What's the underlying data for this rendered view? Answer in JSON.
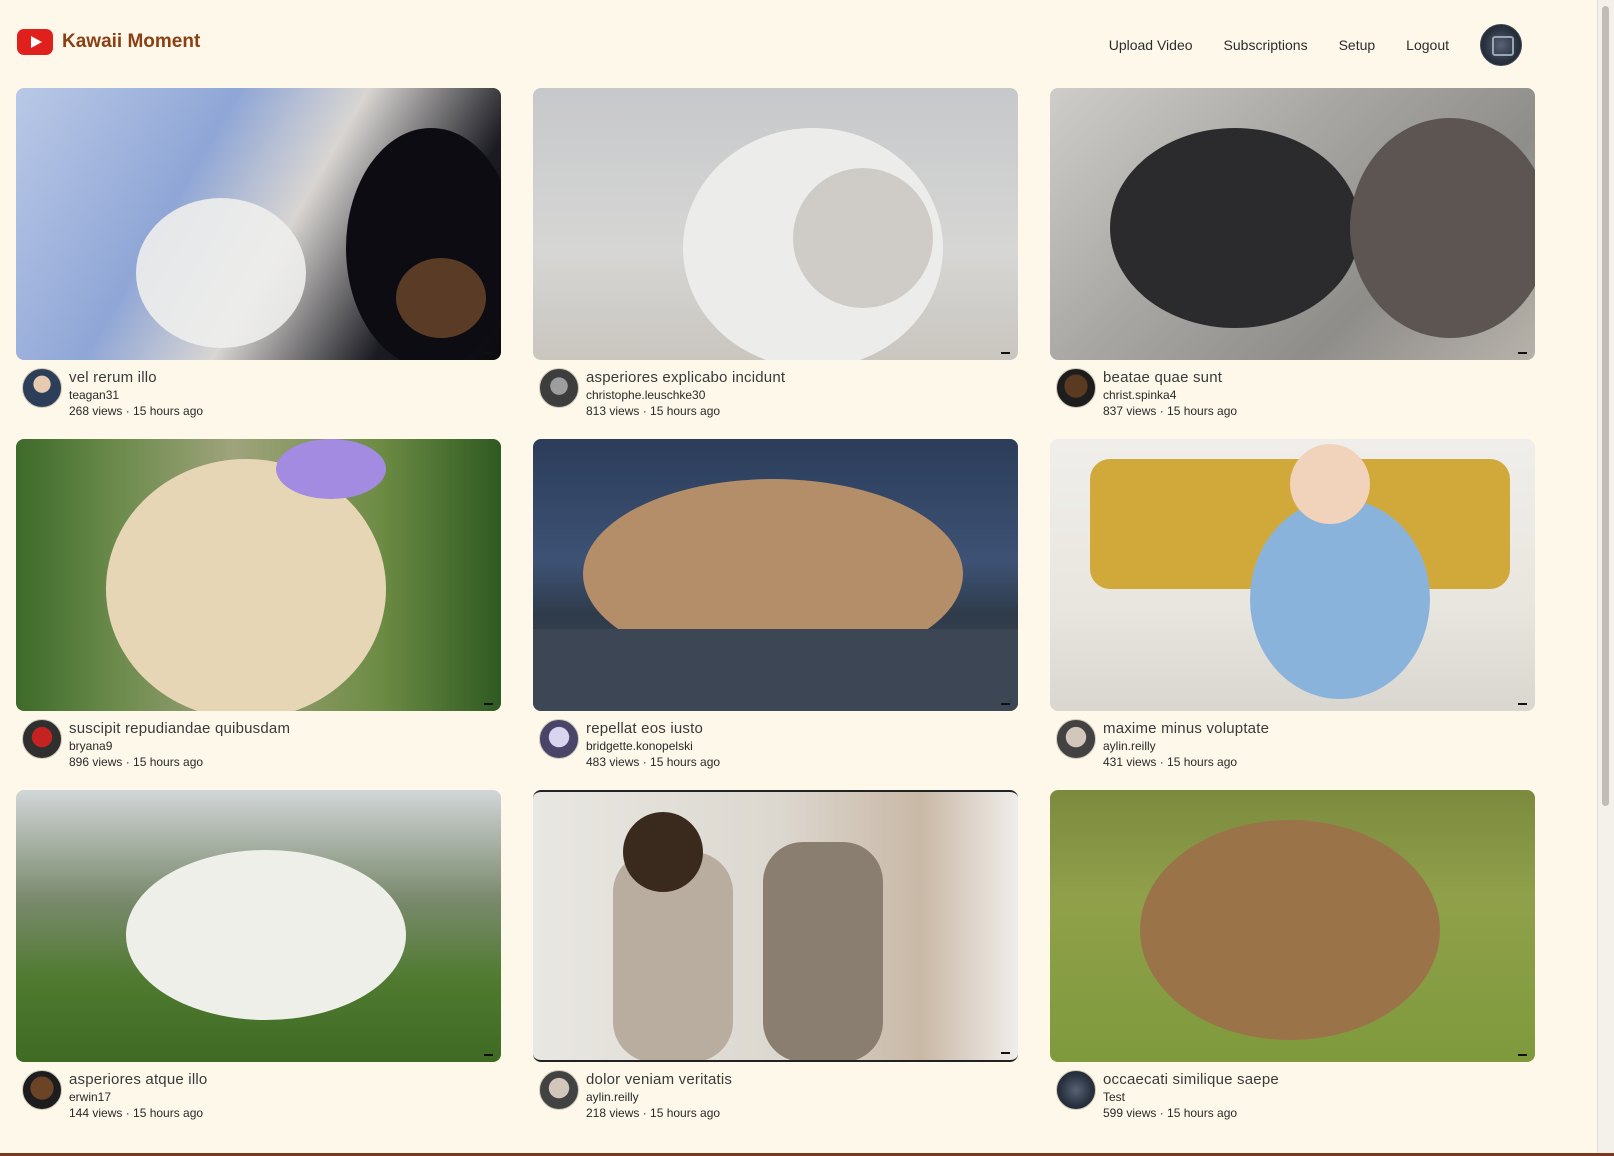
{
  "app": {
    "brand_name": "Kawaii Moment",
    "accent_color": "#e0201d",
    "brand_color": "#8c3f12"
  },
  "nav": {
    "upload_label": "Upload Video",
    "subscriptions_label": "Subscriptions",
    "setup_label": "Setup",
    "logout_label": "Logout"
  },
  "videos": [
    {
      "title": "vel rerum illo",
      "channel": "teagan31",
      "stats": "268 views · 15 hours ago"
    },
    {
      "title": "asperiores explicabo incidunt",
      "channel": "christophe.leuschke30",
      "stats": "813 views · 15 hours ago"
    },
    {
      "title": "beatae quae sunt",
      "channel": "christ.spinka4",
      "stats": "837 views · 15 hours ago"
    },
    {
      "title": "suscipit repudiandae quibusdam",
      "channel": "bryana9",
      "stats": "896 views · 15 hours ago"
    },
    {
      "title": "repellat eos iusto",
      "channel": "bridgette.konopelski",
      "stats": "483 views · 15 hours ago"
    },
    {
      "title": "maxime minus voluptate",
      "channel": "aylin.reilly",
      "stats": "431 views · 15 hours ago"
    },
    {
      "title": "asperiores atque illo",
      "channel": "erwin17",
      "stats": "144 views · 15 hours ago"
    },
    {
      "title": "dolor veniam veritatis",
      "channel": "aylin.reilly",
      "stats": "218 views · 15 hours ago"
    },
    {
      "title": "occaecati similique saepe",
      "channel": "Test",
      "stats": "599 views · 15 hours ago"
    }
  ]
}
